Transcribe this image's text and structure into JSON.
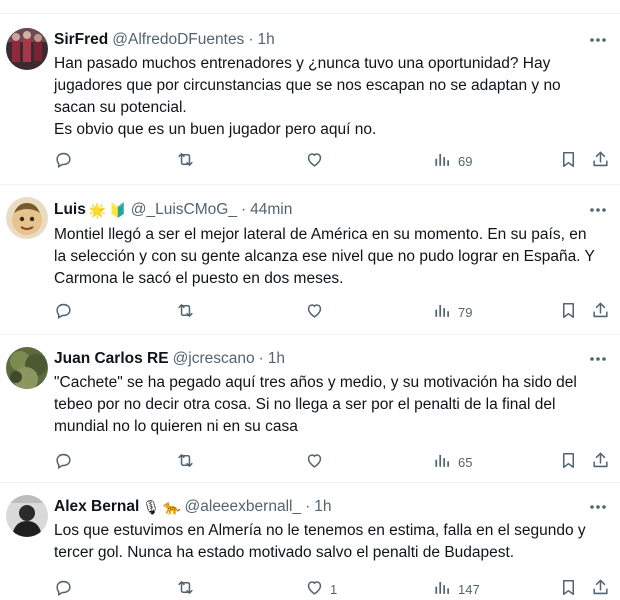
{
  "tweets": [
    {
      "name": "SirFred",
      "handle": "@AlfredoDFuentes",
      "dot": "·",
      "time": "1h",
      "text": "Han pasado muchos entrenadores y ¿nunca tuvo una oportunidad? Hay jugadores que por circunstancias que se nos escapan no se adaptan y no sacan su potencial.\nEs obvio que es un buen jugador pero aquí no.",
      "badges": [],
      "replies": "",
      "retweets": "",
      "likes": "",
      "views": "69"
    },
    {
      "name": "Luis",
      "handle": "@_LuisCMoG_",
      "dot": "·",
      "time": "44min",
      "text": "Montiel llegó a ser el mejor lateral de América en su momento. En su país, en la selección y con su gente alcanza ese nivel que no pudo lograr en España. Y Carmona le sacó el puesto en dos meses.",
      "badges": [
        "🌟",
        "🔰"
      ],
      "replies": "",
      "retweets": "",
      "likes": "",
      "views": "79"
    },
    {
      "name": "Juan Carlos RE",
      "handle": "@jcrescano",
      "dot": "·",
      "time": "1h",
      "text": "\"Cachete\" se ha pegado aquí tres años y medio, y su motivación ha sido del tebeo por no decir otra cosa. Si no llega a ser por el penalti de la final del mundial no lo quieren ni en su casa",
      "badges": [],
      "replies": "",
      "retweets": "",
      "likes": "",
      "views": "65"
    },
    {
      "name": "Alex Bernal",
      "handle": "@aleeexbernall_",
      "dot": "·",
      "time": "1h",
      "text": "Los que estuvimos en Almería no le tenemos en estima, falla en el segundo y tercer gol. Nunca ha estado motivado salvo el penalti de Budapest.",
      "badges": [
        "🎙",
        "🐆"
      ],
      "replies": "",
      "retweets": "",
      "likes": "1",
      "views": "147"
    }
  ],
  "colors": {
    "text": "#0f1419",
    "muted": "#536471",
    "divider": "#eff3f4"
  },
  "icons": [
    "more-icon",
    "reply-icon",
    "retweet-icon",
    "like-icon",
    "views-icon",
    "bookmark-icon",
    "share-icon"
  ]
}
